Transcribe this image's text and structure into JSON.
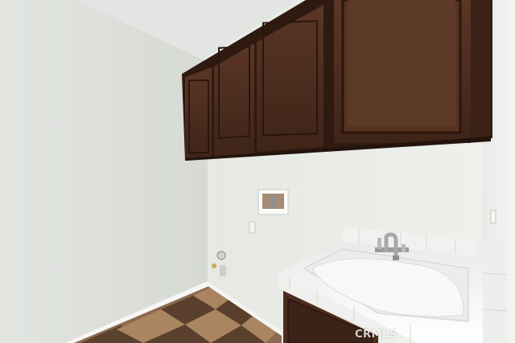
{
  "scene": {
    "description_free": true,
    "watermark": "CRMLS"
  },
  "colors": {
    "wall_left": "#e4e6e2",
    "wall_back": "#eceeea",
    "ceiling": "#e6e8e6",
    "cabinet": "#4a2c1e",
    "cabinet_dark": "#2f1b12",
    "floor_light": "#a88460",
    "floor_dark": "#5a402c",
    "sink": "#f7f7f7",
    "tile": "#f1f1ef"
  }
}
